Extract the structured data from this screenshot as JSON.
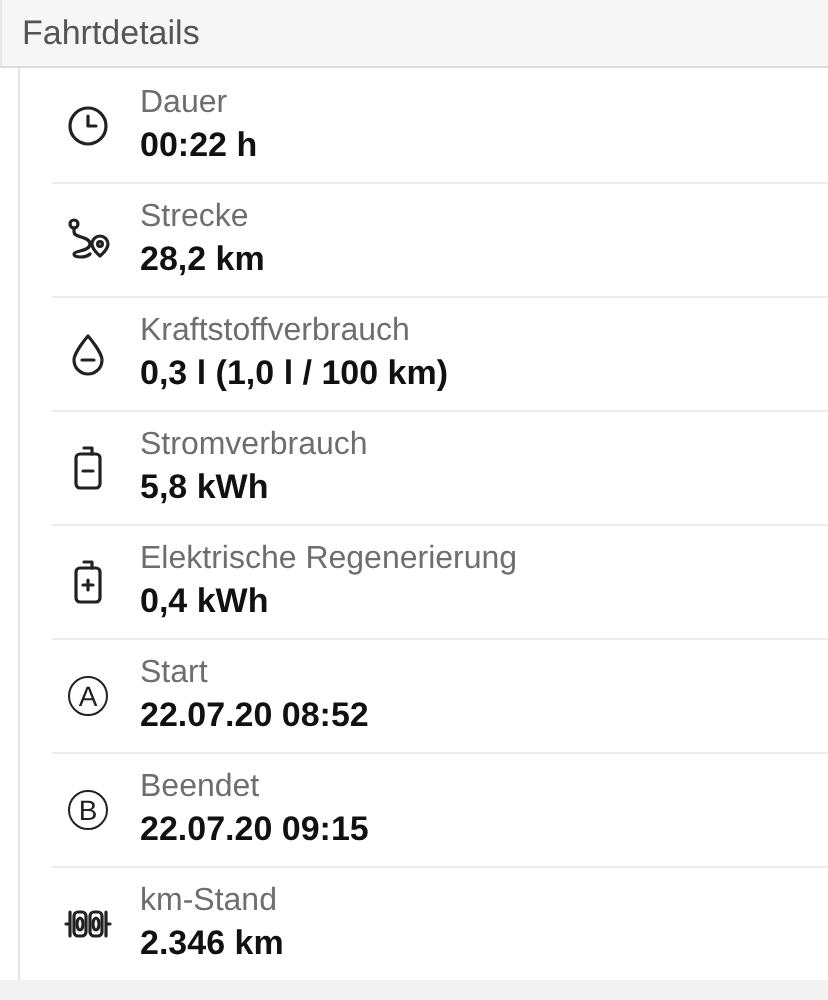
{
  "section": {
    "title": "Fahrtdetails"
  },
  "items": [
    {
      "kind": "clock",
      "label": "Dauer",
      "value": "00:22 h"
    },
    {
      "kind": "route",
      "label": "Strecke",
      "value": "28,2 km"
    },
    {
      "kind": "drop",
      "label": "Kraftstoffverbrauch",
      "value": "0,3 l (1,0 l / 100 km)"
    },
    {
      "kind": "battery-minus",
      "label": "Stromverbrauch",
      "value": "5,8 kWh"
    },
    {
      "kind": "battery-plus",
      "label": "Elektrische Regenerierung",
      "value": "0,4 kWh"
    },
    {
      "kind": "letter",
      "letter": "A",
      "label": "Start",
      "value": "22.07.20 08:52"
    },
    {
      "kind": "letter",
      "letter": "B",
      "label": "Beendet",
      "value": "22.07.20 09:15"
    },
    {
      "kind": "odometer",
      "label": "km-Stand",
      "value": "2.346 km"
    }
  ]
}
